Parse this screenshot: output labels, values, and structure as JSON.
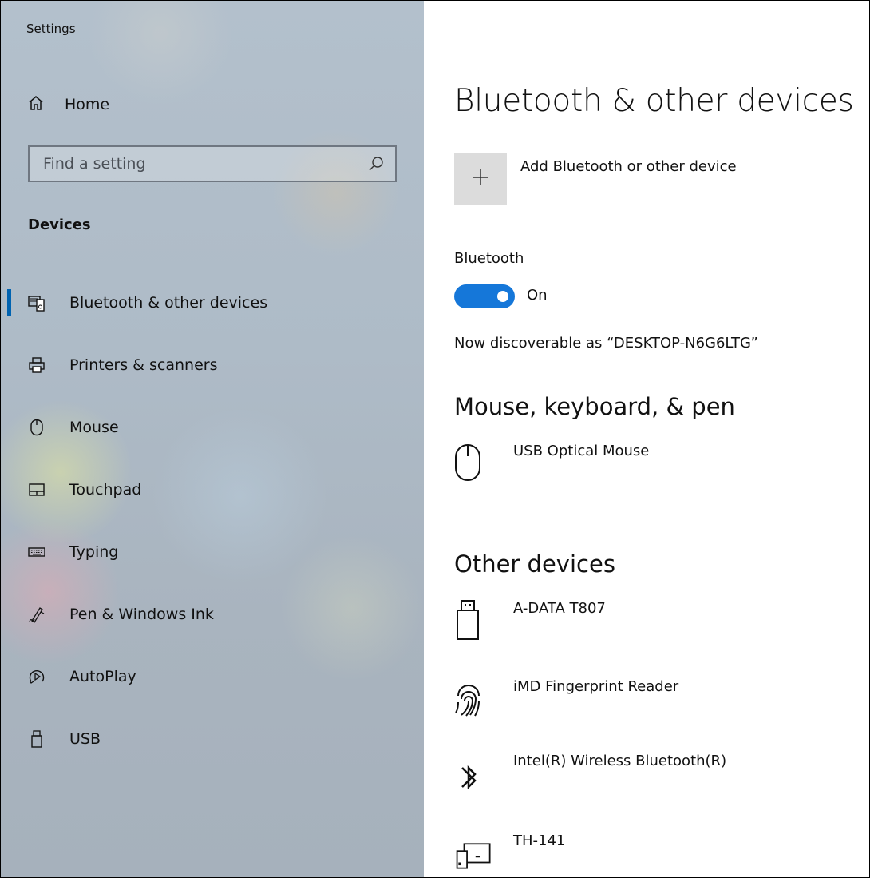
{
  "app": {
    "title": "Settings"
  },
  "sidebar": {
    "home_label": "Home",
    "search_placeholder": "Find a setting",
    "section_label": "Devices",
    "items": [
      {
        "label": "Bluetooth & other devices",
        "icon": "bluetooth-devices-icon",
        "active": true
      },
      {
        "label": "Printers & scanners",
        "icon": "printer-icon"
      },
      {
        "label": "Mouse",
        "icon": "mouse-icon"
      },
      {
        "label": "Touchpad",
        "icon": "touchpad-icon"
      },
      {
        "label": "Typing",
        "icon": "keyboard-icon"
      },
      {
        "label": "Pen & Windows Ink",
        "icon": "pen-icon"
      },
      {
        "label": "AutoPlay",
        "icon": "autoplay-icon"
      },
      {
        "label": "USB",
        "icon": "usb-icon"
      }
    ]
  },
  "main": {
    "title": "Bluetooth & other devices",
    "add_device_label": "Add Bluetooth or other device",
    "bluetooth": {
      "label": "Bluetooth",
      "state": "On",
      "discoverable": "Now discoverable as “DESKTOP-N6G6LTG”"
    },
    "mouse_section": {
      "heading": "Mouse, keyboard, & pen",
      "devices": [
        {
          "name": "USB Optical Mouse",
          "icon": "mouse-icon"
        }
      ]
    },
    "other_section": {
      "heading": "Other devices",
      "devices": [
        {
          "name": "A-DATA T807",
          "icon": "usb-drive-icon"
        },
        {
          "name": "iMD Fingerprint Reader",
          "icon": "fingerprint-icon"
        },
        {
          "name": "Intel(R) Wireless Bluetooth(R)",
          "icon": "bluetooth-icon"
        },
        {
          "name": "TH-141",
          "icon": "devices-icon"
        }
      ]
    }
  },
  "colors": {
    "accent": "#0063b1",
    "toggle_on": "#1577d9"
  }
}
